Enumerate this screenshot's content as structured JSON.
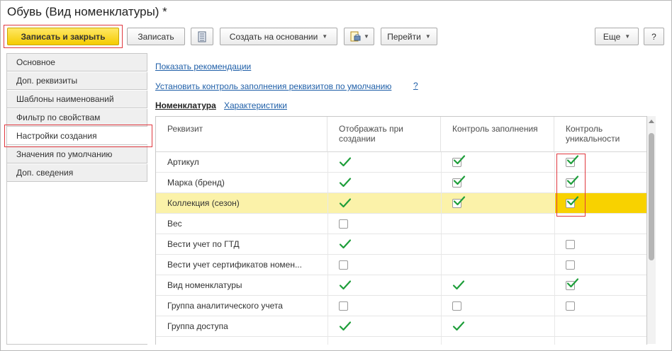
{
  "window": {
    "title": "Обувь (Вид номенклатуры) *"
  },
  "toolbar": {
    "save_close": "Записать и закрыть",
    "save": "Записать",
    "create_based": "Создать на основании",
    "goto": "Перейти",
    "more": "Еще",
    "help": "?"
  },
  "sidebar": {
    "items": [
      {
        "label": "Основное"
      },
      {
        "label": "Доп. реквизиты"
      },
      {
        "label": "Шаблоны наименований"
      },
      {
        "label": "Фильтр по свойствам"
      },
      {
        "label": "Настройки создания",
        "active": true
      },
      {
        "label": "Значения по умолчанию"
      },
      {
        "label": "Доп. сведения"
      }
    ]
  },
  "main": {
    "show_recommendations": "Показать рекомендации",
    "default_control": "Установить контроль заполнения реквизитов по умолчанию",
    "help_link": "?",
    "tabs": [
      {
        "label": "Номенклатура",
        "active": true
      },
      {
        "label": "Характеристики"
      }
    ]
  },
  "table": {
    "headers": [
      "Реквизит",
      "Отображать при создании",
      "Контроль заполнения",
      "Контроль уникальности"
    ],
    "rows": [
      {
        "name": "Артикул",
        "display": "check",
        "fill": "box-checked",
        "unique": "box-checked"
      },
      {
        "name": "Марка (бренд)",
        "display": "check",
        "fill": "box-checked",
        "unique": "box-checked"
      },
      {
        "name": "Коллекция (сезон)",
        "display": "check",
        "fill": "box-checked",
        "unique": "box-checked",
        "selected": true
      },
      {
        "name": "Вес",
        "display": "box",
        "fill": "none",
        "unique": "none"
      },
      {
        "name": "Вести учет по ГТД",
        "display": "check",
        "fill": "none",
        "unique": "box"
      },
      {
        "name": "Вести учет сертификатов номен...",
        "display": "box",
        "fill": "none",
        "unique": "box"
      },
      {
        "name": "Вид номенклатуры",
        "display": "check",
        "fill": "check",
        "unique": "box-checked"
      },
      {
        "name": "Группа аналитического учета",
        "display": "box",
        "fill": "box",
        "unique": "box"
      },
      {
        "name": "Группа доступа",
        "display": "check",
        "fill": "check",
        "unique": "none"
      },
      {
        "name": "",
        "display": "none",
        "fill": "none",
        "unique": "none"
      }
    ]
  },
  "colors": {
    "accent_yellow": "#f8d200",
    "selection_row": "#fbf2a9",
    "check_green": "#1e9e3a",
    "link_blue": "#1f5fa8",
    "highlight_red": "#e0383f"
  }
}
